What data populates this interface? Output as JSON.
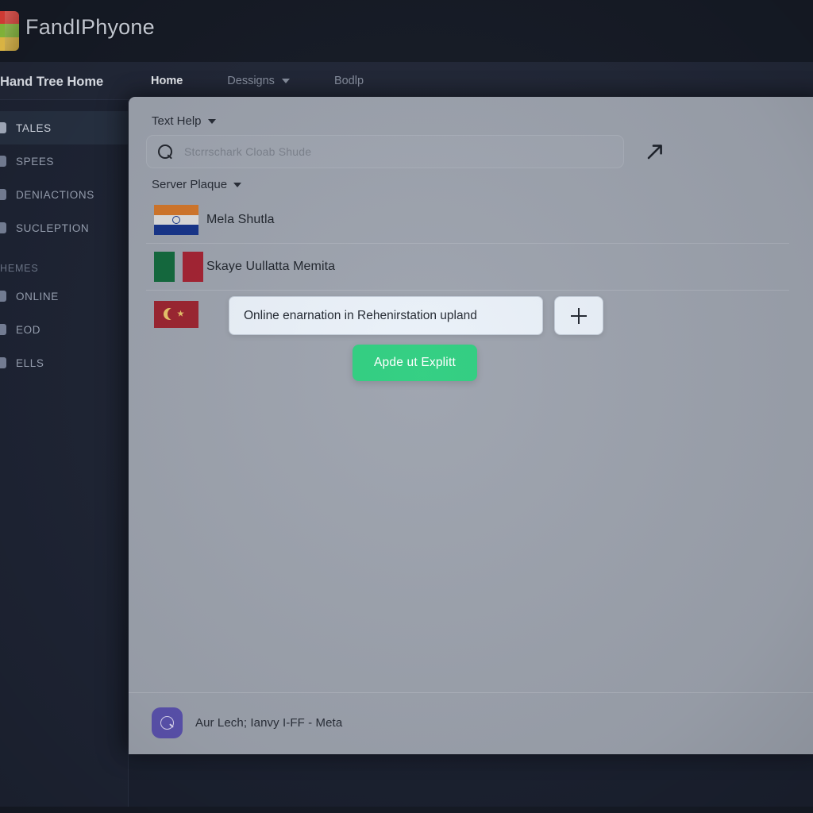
{
  "brand": {
    "name": "FandIPhyone",
    "logo_icon": "layered-blocks-logo-icon"
  },
  "nav": {
    "home_label": "Hand Tree Home",
    "tabs": [
      {
        "label": "Home",
        "has_caret": false,
        "active": true
      },
      {
        "label": "Dessigns",
        "has_caret": true,
        "active": false
      },
      {
        "label": "Bodlp",
        "has_caret": false,
        "active": false
      }
    ]
  },
  "sidebar": {
    "items": [
      {
        "label": "TALES",
        "active": true
      },
      {
        "label": "SPEES",
        "active": false
      },
      {
        "label": "DENIACTIONS",
        "active": false
      },
      {
        "label": "SUCLEPTION",
        "active": false
      }
    ],
    "group_label": "HEMES",
    "items2": [
      {
        "label": "ONLINE",
        "active": false
      },
      {
        "label": "EOD",
        "active": false
      },
      {
        "label": "ELLS",
        "active": false
      }
    ]
  },
  "modal": {
    "text_help_label": "Text Help",
    "server_plaque_label": "Server Plaque",
    "search": {
      "placeholder": "Stcrrschark  Cloab Shude",
      "value": "",
      "icon": "search-icon"
    },
    "arrow_icon": "arrow-up-right-icon",
    "rows": [
      {
        "label": "Mela Shutla",
        "flag": "india",
        "editing": false
      },
      {
        "label": "Skaye Uullatta Memita",
        "flag": "italy",
        "editing": false
      },
      {
        "label": "",
        "flag": "turkey",
        "editing": true
      }
    ],
    "edit_field_value": "Online enarnation in Rehenirstation upland",
    "add_button_icon": "plus-icon",
    "primary_button_label": "Apde ut Explitt",
    "footer": {
      "avatar_icon": "user-badge-icon",
      "text": "Aur Lech; Ianvy I-FF - Meta"
    }
  },
  "colors": {
    "accent_green": "#2fce80",
    "app_dark": "#1b2130",
    "panel_gray": "#9da3ae",
    "avatar_purple": "#5b52ae"
  }
}
